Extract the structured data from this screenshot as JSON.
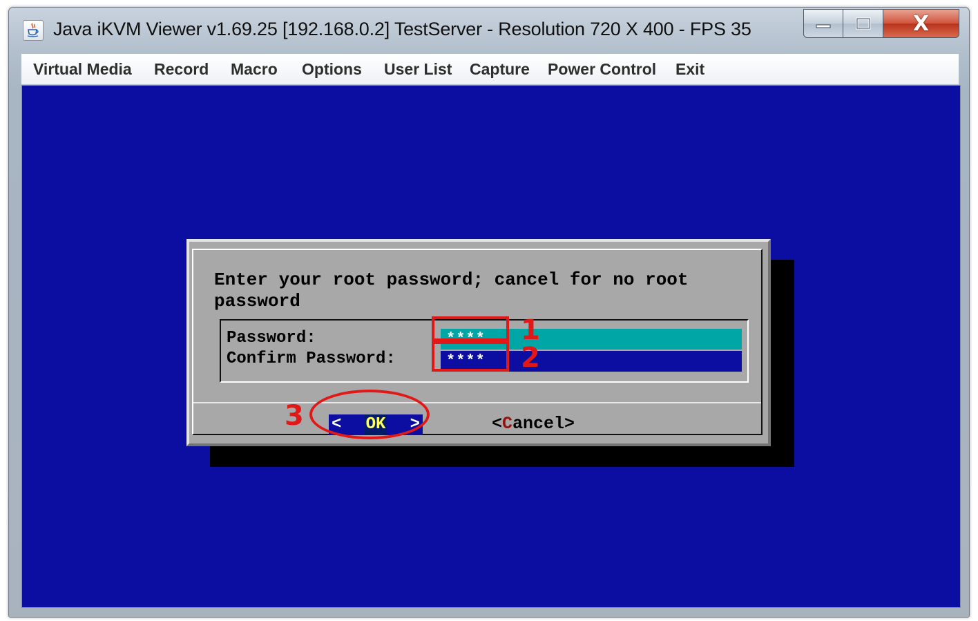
{
  "window": {
    "title": "Java iKVM Viewer v1.69.25 [192.168.0.2] TestServer - Resolution 720 X 400 - FPS 35",
    "app_icon": "java-cup-icon",
    "controls": {
      "minimize_icon": "minimize-icon",
      "maximize_icon": "maximize-icon",
      "close_label": "X"
    }
  },
  "menu": [
    "Virtual Media",
    "Record",
    "Macro",
    "Options",
    "User List",
    "Capture",
    "Power Control",
    "Exit"
  ],
  "dialog": {
    "prompt_line1": "Enter your root password; cancel for no root",
    "prompt_line2": "password",
    "password_label": "Password:",
    "password_value": "****",
    "confirm_label": "Confirm Password:",
    "confirm_value": "****",
    "ok_left": "<",
    "ok_label": "OK",
    "ok_right": ">",
    "cancel_left": "<",
    "cancel_hotkey": "C",
    "cancel_rest": "ancel",
    "cancel_right": ">"
  },
  "annotations": {
    "step1": "1",
    "step2": "2",
    "step3": "3",
    "color": "#e01818"
  },
  "colors": {
    "console_background": "#0b0ea0",
    "dialog_background": "#a8a8a8",
    "active_field": "#00a5a5"
  }
}
